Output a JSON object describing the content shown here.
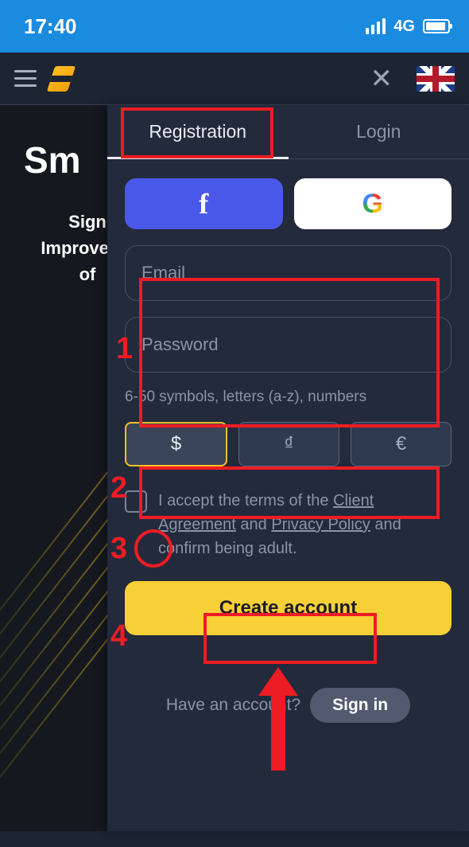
{
  "status": {
    "time": "17:40",
    "net": "4G"
  },
  "tabs": {
    "registration": "Registration",
    "login": "Login"
  },
  "backdrop": {
    "title_fragment": "Sm",
    "sub_l1": "Sign",
    "sub_l2": "Improve yo",
    "sub_l3": "of"
  },
  "form": {
    "email_placeholder": "Email",
    "password_placeholder": "Password",
    "hint": "6-50 symbols, letters (a-z), numbers"
  },
  "currency": {
    "opt1": "$",
    "opt2": "₫",
    "opt3": "€"
  },
  "terms": {
    "t1": "I accept the terms of the ",
    "link1": "Client Agreement",
    "t2": " and ",
    "link2": "Privacy Policy",
    "t3": " and confirm being adult."
  },
  "buttons": {
    "create": "Create account",
    "signin": "Sign in"
  },
  "signin_q": "Have an account?",
  "annotations": {
    "n1": "1",
    "n2": "2",
    "n3": "3",
    "n4": "4"
  }
}
